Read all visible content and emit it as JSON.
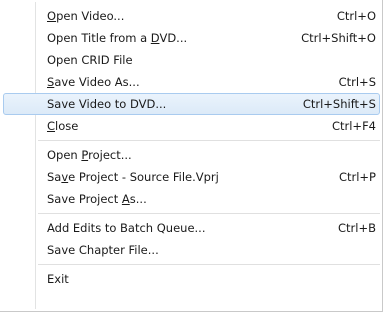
{
  "menu": {
    "groups": [
      {
        "items": [
          {
            "pre": "",
            "acc": "O",
            "post": "pen Video...",
            "shortcut": "Ctrl+O"
          },
          {
            "pre": "Open Title from a ",
            "acc": "D",
            "post": "VD...",
            "shortcut": "Ctrl+Shift+O"
          },
          {
            "pre": "Open CRID File",
            "acc": "",
            "post": "",
            "shortcut": ""
          },
          {
            "pre": "",
            "acc": "S",
            "post": "ave Video As...",
            "shortcut": "Ctrl+S"
          },
          {
            "pre": "Save Video to DVD...",
            "acc": "",
            "post": "",
            "shortcut": "Ctrl+Shift+S",
            "highlighted": true
          },
          {
            "pre": "",
            "acc": "C",
            "post": "lose",
            "shortcut": "Ctrl+F4"
          }
        ]
      },
      {
        "items": [
          {
            "pre": "Open ",
            "acc": "P",
            "post": "roject...",
            "shortcut": ""
          },
          {
            "pre": "Sa",
            "acc": "v",
            "post": "e Project - Source File.Vprj",
            "shortcut": "Ctrl+P"
          },
          {
            "pre": "Save Project ",
            "acc": "A",
            "post": "s...",
            "shortcut": ""
          }
        ]
      },
      {
        "items": [
          {
            "pre": "Add Edits to Batch Queue...",
            "acc": "",
            "post": "",
            "shortcut": "Ctrl+B"
          },
          {
            "pre": "Save Chapter File...",
            "acc": "",
            "post": "",
            "shortcut": ""
          }
        ]
      },
      {
        "items": [
          {
            "pre": "Exit",
            "acc": "",
            "post": "",
            "shortcut": ""
          }
        ]
      }
    ]
  }
}
